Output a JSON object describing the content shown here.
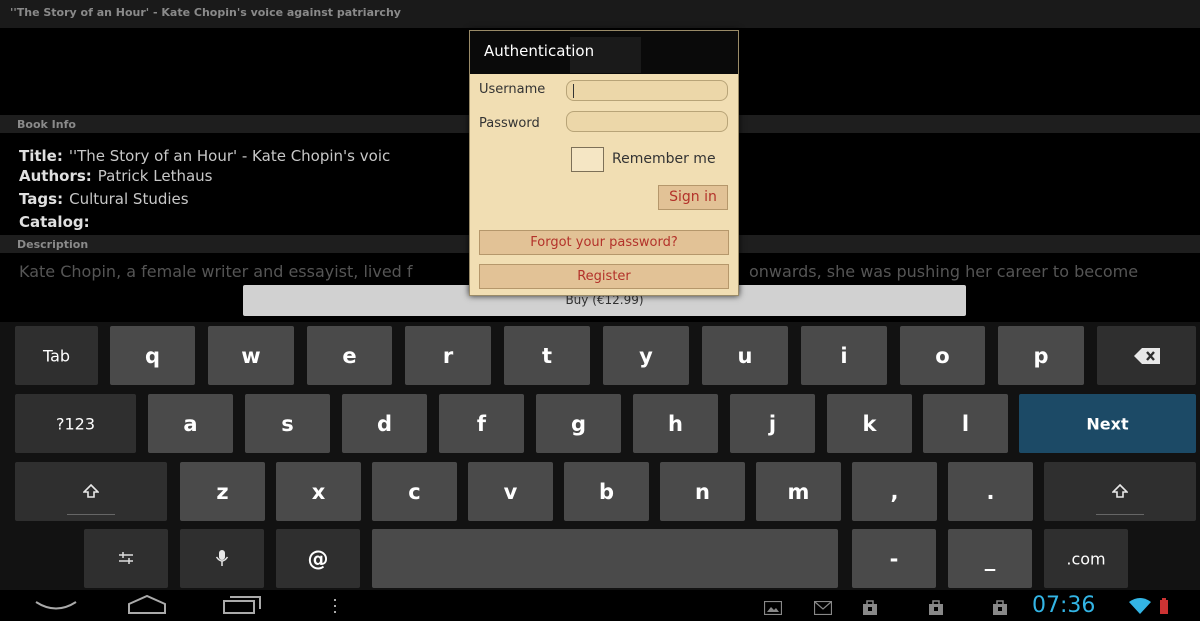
{
  "title_bar": {
    "text": "''The Story of an Hour' - Kate Chopin's voice against patriarchy"
  },
  "book_info": {
    "header": "Book Info",
    "title_label": "Title:",
    "title_value": "''The Story of an Hour' - Kate Chopin's voic",
    "authors_label": "Authors:",
    "authors_value": "Patrick Lethaus",
    "tags_label": "Tags:",
    "tags_value": "Cultural Studies",
    "catalog_label": "Catalog:",
    "catalog_value": ""
  },
  "description": {
    "header": "Description",
    "text_left": "Kate Chopin, a female writer and essayist, lived f",
    "text_right": "onwards, she was pushing her career to become"
  },
  "buy_button": "Buy (€12.99)",
  "auth_dialog": {
    "title": "Authentication",
    "username_label": "Username",
    "username_value": "",
    "password_label": "Password",
    "password_value": "",
    "remember_label": "Remember me",
    "remember_checked": false,
    "signin_label": "Sign in",
    "forgot_label": "Forgot your password?",
    "register_label": "Register"
  },
  "keyboard": {
    "row1": [
      "Tab",
      "q",
      "w",
      "e",
      "r",
      "t",
      "y",
      "u",
      "i",
      "o",
      "p",
      "backspace-icon"
    ],
    "row2": [
      "?123",
      "a",
      "s",
      "d",
      "f",
      "g",
      "h",
      "j",
      "k",
      "l",
      "Next"
    ],
    "row3": [
      "shift-icon",
      "z",
      "x",
      "c",
      "v",
      "b",
      "n",
      "m",
      ",",
      ".",
      "shift-icon"
    ],
    "row4": [
      "settings-icon",
      "mic-icon",
      "@",
      "space",
      "-",
      "_",
      ".com"
    ]
  },
  "status_bar": {
    "time": "07:36",
    "accent_color": "#33b5e5",
    "icons": [
      "back-icon",
      "home-icon",
      "recent-apps-icon",
      "menu-icon",
      "gallery-icon",
      "gmail-icon",
      "shopping-bag-icon",
      "shopping-bag-icon",
      "shopping-bag-icon",
      "wifi-icon",
      "battery-icon"
    ]
  }
}
